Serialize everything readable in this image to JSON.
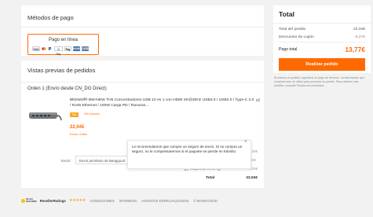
{
  "payment": {
    "title": "Métodos de pago",
    "option_label": "Pago en línea",
    "logos": [
      "VISA",
      "MC",
      "PP",
      "G Pay",
      "Pay",
      "BANK",
      "CARD"
    ]
  },
  "review": {
    "title": "Vistas previas de pedidos",
    "order_title": "Orden 1 (Envío desde CN_DG Direct)",
    "product_title": "BlitzWolf® BW-NEW TH5 Concentradores USB 10 en 1 con HDMI 4K@30Hz USB3.0 / USB2.0 / Type-C 2.0 / RJ45 Ethernet / 100W Carga PD / Ranuras...",
    "quantity": "x1",
    "badge": "TAX",
    "tax_note": "IVA incluido",
    "price": "22,04€",
    "free_shipping": "Envío Gratis",
    "shipping_label": "Envío:",
    "shipping_method": "Envío prioritario de Banggood",
    "shipping_price": "0,00€",
    "right_values": [
      "0,00€",
      "0,00€"
    ],
    "insurance_label": "Seguro de envío",
    "total_label": "Total",
    "total_value": "22,04€"
  },
  "tooltip": {
    "text": "Le recomendamos que compre un seguro de envío. Si no compra un seguro, no le compensaremos si el paquete se pierde en tránsito.",
    "close": "×"
  },
  "summary": {
    "title": "Total",
    "subtotal_label": "Total del pedido",
    "subtotal_value": "22,04€",
    "coupon_label": "Descuento de cupón",
    "coupon_value": "-8,27€",
    "pay_label": "Pago total",
    "pay_value": "13,77€",
    "button": "Realizar pedido"
  },
  "note": "Al realizar un pedido, ingresará un pago de terceros. La información que complete solo se utiliza para procesar su pedido. Para obtener más detalles, consulte Política de privacidad.",
  "footer": {
    "norton": "Norton\nSECURED",
    "reseller": "ResellerRatings",
    "stars": "★★★★★",
    "links": [
      "CONDICIONES",
      "INTIMIDAD",
      "ASUNTOS ESPECIALIZADOS",
      "© BANGGOOD"
    ]
  },
  "colors": {
    "accent": "#ff6a00",
    "badge": "#f5a623"
  }
}
